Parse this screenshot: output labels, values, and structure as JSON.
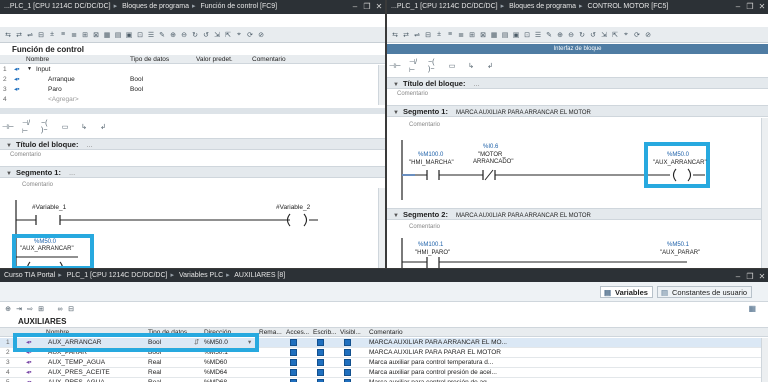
{
  "left": {
    "breadcrumb": [
      "...PLC_1 [CPU 1214C DC/DC/DC]",
      "Bloques de programa",
      "Función de control [FC9]"
    ],
    "interface_title": "Función de control",
    "columns": [
      "Nombre",
      "Tipo de datos",
      "Valor predet.",
      "Comentario"
    ],
    "rows": [
      {
        "num": "1",
        "name": "Input",
        "type": "",
        "value": "",
        "expand": "▼"
      },
      {
        "num": "2",
        "name": "Arranque",
        "type": "Bool",
        "value": ""
      },
      {
        "num": "3",
        "name": "Paro",
        "type": "Bool",
        "value": ""
      },
      {
        "num": "4",
        "name": "<Agregar>",
        "type": "",
        "value": ""
      }
    ],
    "block_title": "Título del bloque:",
    "block_title_dots": "...",
    "comment": "Comentario",
    "segment_label": "Segmento 1:",
    "segment_dots": "...",
    "segment_comment": "Comentario",
    "contact1": "#Variable_1",
    "coil1": "#Variable_2",
    "coil2_addr": "%M50.0",
    "coil2_name": "\"AUX_ARRANCAR\""
  },
  "right": {
    "breadcrumb": [
      "...PLC_1 [CPU 1214C DC/DC/DC]",
      "Bloques de programa",
      "CONTROL MOTOR [FC5]"
    ],
    "interface_header": "Interfaz de bloque",
    "block_title": "Título del bloque:",
    "block_title_dots": "...",
    "comment": "Comentario",
    "seg1_label": "Segmento 1:",
    "seg1_text": "MARCA AUXILIAR PARA ARRANCAR EL MOTOR",
    "seg1_comment": "Comentario",
    "c1_addr": "%M100.0",
    "c1_name": "\"HMI_MARCHA\"",
    "c2_addr": "%I0.6",
    "c2_name1": "\"MOTOR_",
    "c2_name2": "ARRANCADO\"",
    "coil_addr": "%M50.0",
    "coil_name": "\"AUX_ARRANCAR\"",
    "seg2_label": "Segmento 2:",
    "seg2_text": "MARCA AUXILIAR PARA ARRANCAR EL MOTOR",
    "seg2_comment": "Comentario",
    "c3_addr": "%M100.1",
    "c3_name": "\"HMI_PARO\"",
    "coil2_addr": "%M50.1",
    "coil2_name": "\"AUX_PARAR\""
  },
  "bottom": {
    "breadcrumb": [
      "Curso TIA Portal",
      "PLC_1 [CPU 1214C DC/DC/DC]",
      "Variables PLC",
      "AUXILIARES [8]"
    ],
    "tabs": [
      "Variables",
      "Constantes de usuario"
    ],
    "table_title": "AUXILIARES",
    "columns": [
      "Nombre",
      "Tipo de datos",
      "Dirección",
      "Rema...",
      "Acces...",
      "Escrib...",
      "Visibl...",
      "Comentario"
    ],
    "rows": [
      {
        "num": "1",
        "name": "AUX_ARRANCAR",
        "type": "Bool",
        "addr": "%M50.0",
        "comment": "MARCA AUXILIAR PARA ARRANCAR EL MO..."
      },
      {
        "num": "2",
        "name": "AUX_PARAR",
        "type": "Bool",
        "addr": "%M50.1",
        "comment": "MARCA AUXILIAR PARA PARAR EL MOTOR"
      },
      {
        "num": "3",
        "name": "AUX_TEMP_AGUA",
        "type": "Real",
        "addr": "%MD60",
        "comment": "Marca auxiliar para control temperatura d..."
      },
      {
        "num": "4",
        "name": "AUX_PRES_ACEITE",
        "type": "Real",
        "addr": "%MD64",
        "comment": "Marca auxiliar para control presión de acei..."
      },
      {
        "num": "5",
        "name": "AUX_PRES_AGUA",
        "type": "Real",
        "addr": "%MD68",
        "comment": "Marca auxiliar para control presión de ag..."
      }
    ]
  },
  "colors": {
    "highlight": "#27a9df",
    "titlebar": "#2c3136",
    "interface_header": "#4f7ca3"
  }
}
